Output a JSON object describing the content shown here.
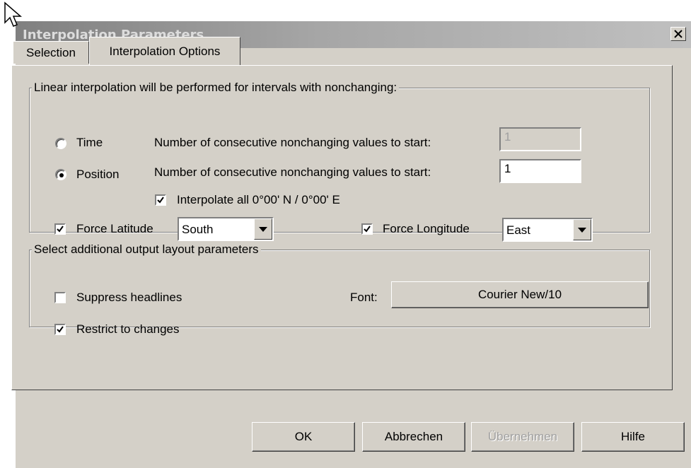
{
  "window": {
    "title": "Interpolation Parameters"
  },
  "tabs": [
    {
      "label": "Selection"
    },
    {
      "label": "Interpolation Options"
    }
  ],
  "group_interpolation": {
    "label": "Linear interpolation will be  performed for intervals with nonchanging:",
    "time": {
      "label": "Time",
      "selected": false,
      "count_label": "Number of consecutive nonchanging values to start:",
      "count_value": "1",
      "count_enabled": false
    },
    "position": {
      "label": "Position",
      "selected": true,
      "count_label": "Number of consecutive nonchanging values to start:",
      "count_value": "1",
      "count_enabled": true
    },
    "interpolate_zero": {
      "label": "Interpolate all 0°00' N / 0°00' E",
      "checked": true
    },
    "force_latitude": {
      "label": "Force Latitude",
      "checked": true,
      "value": "South"
    },
    "force_longitude": {
      "label": "Force Longitude",
      "checked": true,
      "value": "East"
    }
  },
  "group_layout": {
    "label": "Select additional output layout parameters",
    "suppress_headlines": {
      "label": "Suppress headlines",
      "checked": false
    },
    "restrict_changes": {
      "label": "Restrict to changes",
      "checked": true
    },
    "font_label": "Font:",
    "font_button": "Courier New/10"
  },
  "buttons": {
    "ok": "OK",
    "cancel": "Abbrechen",
    "apply": "Übernehmen",
    "help": "Hilfe"
  },
  "icons": {
    "close": "close-icon",
    "cursor": "mouse-pointer-icon",
    "check": "checkmark-icon",
    "dropdown": "chevron-down-icon"
  },
  "colors": {
    "dialog_face": "#d4d0c8",
    "title_inactive_start": "#808080",
    "title_inactive_end": "#c0c0c0",
    "disabled_text": "#a0a0a0"
  }
}
